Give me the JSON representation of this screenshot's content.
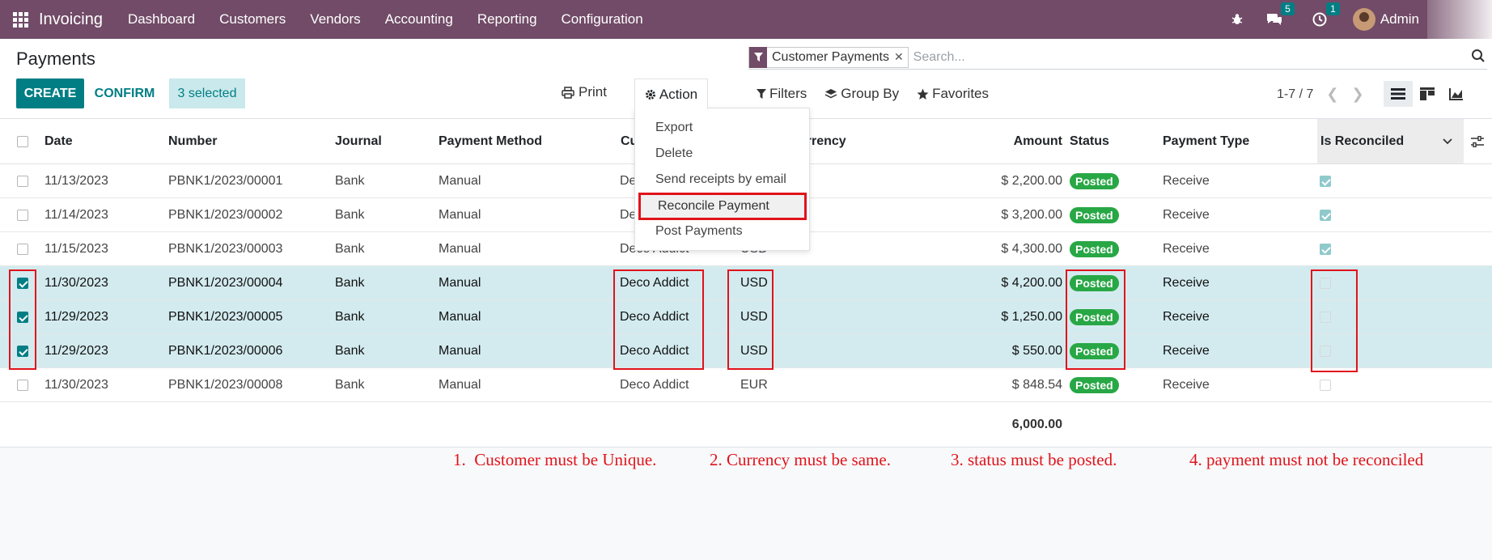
{
  "navbar": {
    "brand": "Invoicing",
    "menu": [
      "Dashboard",
      "Customers",
      "Vendors",
      "Accounting",
      "Reporting",
      "Configuration"
    ],
    "messages_count": "5",
    "activities_count": "1",
    "user": "Admin"
  },
  "control": {
    "title": "Payments",
    "create_label": "CREATE",
    "confirm_label": "CONFIRM",
    "selected_label": "3 selected",
    "print_label": "Print",
    "action_label": "Action",
    "search": {
      "facet": "Customer Payments",
      "placeholder": "Search..."
    },
    "filters_label": "Filters",
    "groupby_label": "Group By",
    "favorites_label": "Favorites",
    "pager": "1-7 / 7"
  },
  "action_menu": [
    "Export",
    "Delete",
    "Send receipts by email",
    "Reconcile Payment",
    "Post Payments"
  ],
  "table": {
    "headers": {
      "date": "Date",
      "number": "Number",
      "journal": "Journal",
      "payment_method": "Payment Method",
      "customer": "Cu",
      "currency": "urrency",
      "amount": "Amount",
      "status": "Status",
      "payment_type": "Payment Type",
      "is_reconciled": "Is Reconciled"
    },
    "rows": [
      {
        "date": "11/13/2023",
        "number": "PBNK1/2023/00001",
        "journal": "Bank",
        "method": "Manual",
        "customer": "Deco",
        "currency": "",
        "amount": "$ 2,200.00",
        "status": "Posted",
        "type": "Receive"
      },
      {
        "date": "11/14/2023",
        "number": "PBNK1/2023/00002",
        "journal": "Bank",
        "method": "Manual",
        "customer": "De",
        "currency": "",
        "amount": "$ 3,200.00",
        "status": "Posted",
        "type": "Receive"
      },
      {
        "date": "11/15/2023",
        "number": "PBNK1/2023/00003",
        "journal": "Bank",
        "method": "Manual",
        "customer": "Deco Addict",
        "currency": "USD",
        "amount": "$ 4,300.00",
        "status": "Posted",
        "type": "Receive"
      },
      {
        "date": "11/30/2023",
        "number": "PBNK1/2023/00004",
        "journal": "Bank",
        "method": "Manual",
        "customer": "Deco Addict",
        "currency": "USD",
        "amount": "$ 4,200.00",
        "status": "Posted",
        "type": "Receive"
      },
      {
        "date": "11/29/2023",
        "number": "PBNK1/2023/00005",
        "journal": "Bank",
        "method": "Manual",
        "customer": "Deco Addict",
        "currency": "USD",
        "amount": "$ 1,250.00",
        "status": "Posted",
        "type": "Receive"
      },
      {
        "date": "11/29/2023",
        "number": "PBNK1/2023/00006",
        "journal": "Bank",
        "method": "Manual",
        "customer": "Deco Addict",
        "currency": "USD",
        "amount": "$ 550.00",
        "status": "Posted",
        "type": "Receive"
      },
      {
        "date": "11/30/2023",
        "number": "PBNK1/2023/00008",
        "journal": "Bank",
        "method": "Manual",
        "customer": "Deco Addict",
        "currency": "EUR",
        "amount": "$ 848.54",
        "status": "Posted",
        "type": "Receive"
      }
    ],
    "total": "6,000.00"
  },
  "notes": [
    "1.  Customer must be Unique.",
    "2. Currency must be same.",
    "3. status must be posted.",
    "4. payment must not be reconciled"
  ],
  "colors": {
    "navbar": "#714b67",
    "primary": "#017e84",
    "posted": "#28a745",
    "highlight": "#e0131b",
    "selected_row": "#d3ebef"
  }
}
